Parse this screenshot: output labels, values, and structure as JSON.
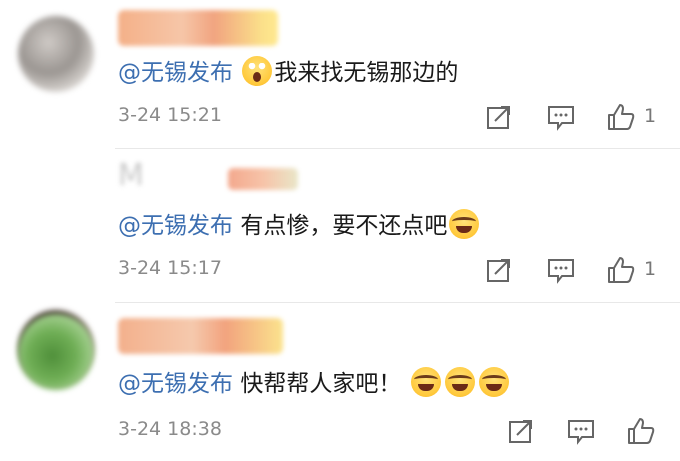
{
  "comments": [
    {
      "mention": "@无锡发布",
      "text": "我来找无锡那边的",
      "emoji_position": "before",
      "emojis": [
        "astonished-emoji"
      ],
      "time": "3-24 15:21",
      "like_count": "1"
    },
    {
      "username_partial": "M",
      "mention": "@无锡发布",
      "text": "有点惨，要不还点吧",
      "emoji_position": "after",
      "emojis": [
        "laugh-cry-emoji"
      ],
      "time": "3-24 15:17",
      "like_count": "1"
    },
    {
      "mention": "@无锡发布",
      "text": "快帮帮人家吧！",
      "emoji_position": "after",
      "emojis": [
        "laugh-cry-emoji",
        "laugh-cry-emoji",
        "laugh-cry-emoji"
      ],
      "time": "3-24 18:38",
      "like_count": ""
    }
  ],
  "colors": {
    "mention": "#3d6fb1",
    "timestamp": "#8a8a8a",
    "icon": "#666666"
  },
  "icons": [
    "share-icon",
    "comment-icon",
    "like-icon"
  ]
}
